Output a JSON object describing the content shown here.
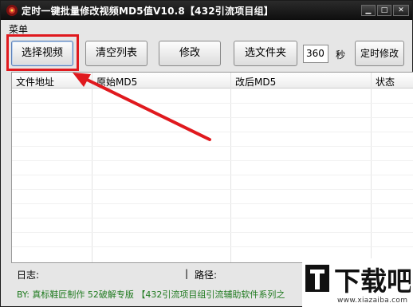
{
  "window": {
    "title": "定时一键批量修改视频MD5值V10.8【432引流项目组】",
    "minimize_glyph": "▁",
    "maximize_glyph": "□",
    "close_glyph": "✕"
  },
  "menu": {
    "items": [
      "菜单"
    ]
  },
  "toolbar": {
    "select_video": "选择视频",
    "clear_list": "清空列表",
    "modify": "修改",
    "select_folder": "选文件夹",
    "seconds_value": "360",
    "seconds_unit": "秒",
    "timed_modify": "定时修改"
  },
  "table": {
    "columns": [
      "文件地址",
      "原始MD5",
      "改后MD5",
      "状态"
    ],
    "rows": []
  },
  "status": {
    "log_label": "日志:",
    "separator": "|",
    "path_label": "路径:"
  },
  "footer": {
    "text": "BY: 真标鞋匠制作 52破解专版 【432引流项目组引流辅助软件系列之"
  },
  "watermark": {
    "logo_text": "下载吧",
    "url": "www.xiazaiba.com"
  },
  "colors": {
    "highlight": "#e0191e",
    "footer_text": "#1f7a1f",
    "titlebar": "#1a1a1a"
  },
  "icons": [
    "app-icon",
    "minimize-icon",
    "maximize-icon",
    "close-icon",
    "arrow-annotation"
  ]
}
